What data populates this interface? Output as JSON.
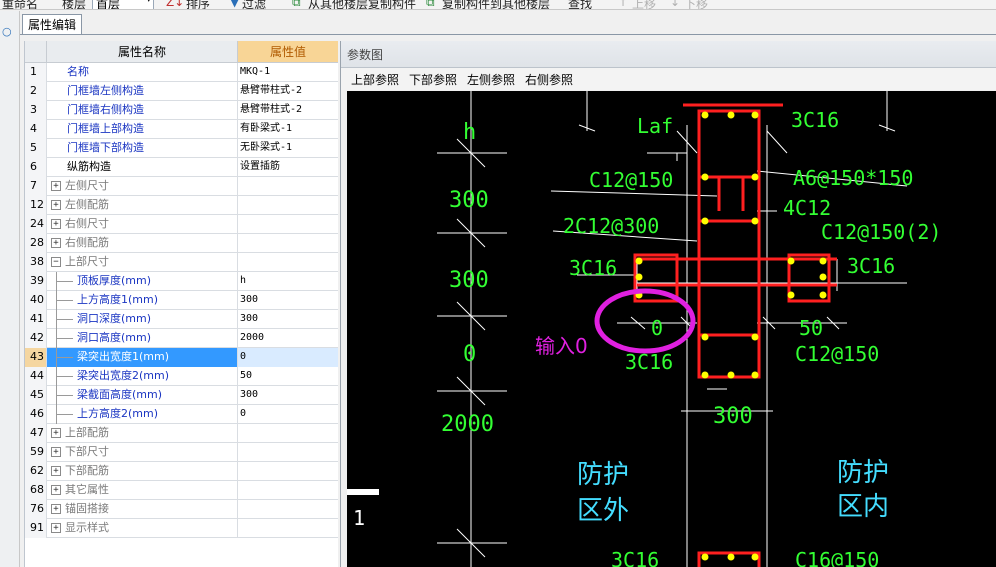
{
  "toolbar": {
    "rename_label": "重命名",
    "floor_label": "楼层",
    "floor_value": "首层",
    "sort_label": "排序",
    "filter_label": "过滤",
    "copy_from_label": "从其他楼层复制构件",
    "copy_to_label": "复制构件到其他楼层",
    "find_label": "查找",
    "move_up_label": "上移",
    "move_down_label": "下移"
  },
  "tab": {
    "label": "属性编辑"
  },
  "grid": {
    "col_name": "属性名称",
    "col_value": "属性值",
    "rows": [
      {
        "num": "1",
        "name": "名称",
        "value": "MKQ-1",
        "style": "blue",
        "indent": 0,
        "expander": ""
      },
      {
        "num": "2",
        "name": "门框墙左侧构造",
        "value": "悬臂带柱式-2",
        "style": "blue",
        "indent": 0,
        "expander": ""
      },
      {
        "num": "3",
        "name": "门框墙右侧构造",
        "value": "悬臂带柱式-2",
        "style": "blue",
        "indent": 0,
        "expander": ""
      },
      {
        "num": "4",
        "name": "门框墙上部构造",
        "value": "有卧梁式-1",
        "style": "blue",
        "indent": 0,
        "expander": ""
      },
      {
        "num": "5",
        "name": "门框墙下部构造",
        "value": "无卧梁式-1",
        "style": "blue",
        "indent": 0,
        "expander": ""
      },
      {
        "num": "6",
        "name": "纵筋构造",
        "value": "设置插筋",
        "style": "black",
        "indent": 0,
        "expander": ""
      },
      {
        "num": "7",
        "name": "左侧尺寸",
        "value": "",
        "style": "grey",
        "indent": 0,
        "expander": "+"
      },
      {
        "num": "12",
        "name": "左侧配筋",
        "value": "",
        "style": "grey",
        "indent": 0,
        "expander": "+"
      },
      {
        "num": "24",
        "name": "右侧尺寸",
        "value": "",
        "style": "grey",
        "indent": 0,
        "expander": "+"
      },
      {
        "num": "28",
        "name": "右侧配筋",
        "value": "",
        "style": "grey",
        "indent": 0,
        "expander": "+"
      },
      {
        "num": "38",
        "name": "上部尺寸",
        "value": "",
        "style": "grey",
        "indent": 0,
        "expander": "−"
      },
      {
        "num": "39",
        "name": "顶板厚度(mm)",
        "value": "h",
        "style": "blue",
        "indent": 1,
        "expander": ""
      },
      {
        "num": "40",
        "name": "上方高度1(mm)",
        "value": "300",
        "style": "blue",
        "indent": 1,
        "expander": ""
      },
      {
        "num": "41",
        "name": "洞口深度(mm)",
        "value": "300",
        "style": "blue",
        "indent": 1,
        "expander": ""
      },
      {
        "num": "42",
        "name": "洞口高度(mm)",
        "value": "2000",
        "style": "blue",
        "indent": 1,
        "expander": ""
      },
      {
        "num": "43",
        "name": "梁突出宽度1(mm)",
        "value": "0",
        "style": "blue",
        "indent": 1,
        "expander": "",
        "selected": true
      },
      {
        "num": "44",
        "name": "梁突出宽度2(mm)",
        "value": "50",
        "style": "blue",
        "indent": 1,
        "expander": ""
      },
      {
        "num": "45",
        "name": "梁截面高度(mm)",
        "value": "300",
        "style": "blue",
        "indent": 1,
        "expander": ""
      },
      {
        "num": "46",
        "name": "上方高度2(mm)",
        "value": "0",
        "style": "blue",
        "indent": 1,
        "expander": ""
      },
      {
        "num": "47",
        "name": "上部配筋",
        "value": "",
        "style": "grey",
        "indent": 0,
        "expander": "+"
      },
      {
        "num": "59",
        "name": "下部尺寸",
        "value": "",
        "style": "grey",
        "indent": 0,
        "expander": "+"
      },
      {
        "num": "62",
        "name": "下部配筋",
        "value": "",
        "style": "grey",
        "indent": 0,
        "expander": "+"
      },
      {
        "num": "68",
        "name": "其它属性",
        "value": "",
        "style": "grey",
        "indent": 0,
        "expander": "+"
      },
      {
        "num": "76",
        "name": "锚固搭接",
        "value": "",
        "style": "grey",
        "indent": 0,
        "expander": "+"
      },
      {
        "num": "91",
        "name": "显示样式",
        "value": "",
        "style": "grey",
        "indent": 0,
        "expander": "+"
      }
    ]
  },
  "panel": {
    "title": "参数图",
    "ref_buttons": [
      "上部参照",
      "下部参照",
      "左侧参照",
      "右侧参照"
    ]
  },
  "drawing": {
    "dims_left": [
      "h",
      "300",
      "300",
      "0",
      "2000"
    ],
    "laf": "Laf",
    "top_right_bar": "3C16",
    "stirrup_top": "C12@150",
    "stirrup_a6": "A6@150*150",
    "bar_2c12": "2C12@300",
    "bar_4c12": "4C12",
    "stirrup_right": "C12@150(2)",
    "left_3c16": "3C16",
    "right_3c16": "3C16",
    "dim_0": "0",
    "dim_50": "50",
    "input_note": "输入0",
    "lower_3c16": "3C16",
    "lower_c12": "C12@150",
    "dim_300": "300",
    "outside_1": "防护",
    "outside_2": "区外",
    "inside_1": "防护",
    "inside_2": "区内",
    "scale_mark": "1",
    "bottom_3c16": "3C16",
    "bottom_c16": "C16@150"
  },
  "colors": {
    "rebar_red": "#ff2020",
    "text_green": "#33ff33",
    "text_cyan": "#44ddff",
    "highlight_magenta": "#e020e0",
    "dots_yellow": "#ffff00"
  }
}
